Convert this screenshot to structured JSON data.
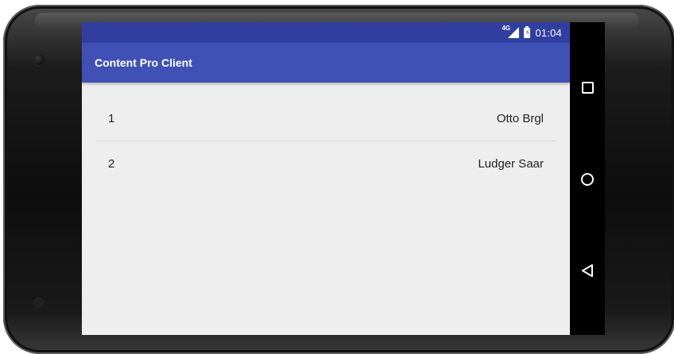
{
  "status_bar": {
    "network_type": "4G",
    "time": "01:04",
    "icons": [
      "signal-icon",
      "battery-charging-icon"
    ]
  },
  "app_bar": {
    "title": "Content Pro Client"
  },
  "list": {
    "items": [
      {
        "id": "1",
        "name": "Otto Brgl"
      },
      {
        "id": "2",
        "name": "Ludger Saar"
      }
    ]
  },
  "nav_bar": {
    "buttons": [
      "recents-icon",
      "home-icon",
      "back-icon"
    ]
  },
  "colors": {
    "status_bar": "#303f9f",
    "app_bar": "#3f51b5",
    "background": "#eeeeee"
  }
}
